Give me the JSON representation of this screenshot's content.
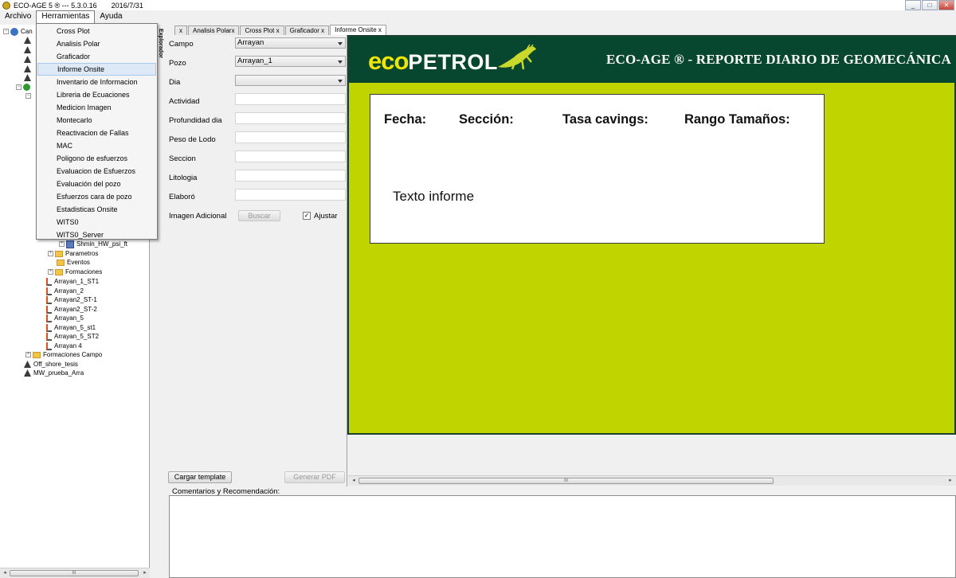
{
  "window": {
    "title": "ECO-AGE 5 ® --- 5.3.0.16",
    "date": "2016/7/31",
    "controls": [
      "_",
      "□",
      "✕"
    ]
  },
  "menubar": [
    "Archivo",
    "Herramientas",
    "Ayuda"
  ],
  "tools_menu": {
    "items": [
      "Cross Plot",
      "Analisis Polar",
      "Graficador",
      "Informe Onsite",
      "Inventario de Informacion",
      "Libreria de Ecuaciones",
      "Medicion Imagen",
      "Montecarlo",
      "Reactivacion de Fallas",
      "MAC",
      "Poligono de esfuerzos",
      "Evaluacion de Esfuerzos",
      "Evaluación del pozo",
      "Esfuerzos cara de pozo",
      "Estadisticas Onsite",
      "WITS0",
      "WITS0_Server"
    ],
    "highlighted": "Informe Onsite"
  },
  "tree": {
    "root_label": "Can",
    "visible_nodes": [
      "Shmin_HW_psi_ft",
      "Parametros",
      "Eventos",
      "Formaciones",
      "Arrayan_1_ST1",
      "Arrayan_2",
      "Arrayan2_ST-1",
      "Arrayan2_ST-2",
      "Arrayan_5",
      "Arrayan_5_st1",
      "Arrayan_5_ST2",
      "Arrayan 4",
      "Formaciones Campo",
      "Off_shore_tesis",
      "MW_prueba_Arra"
    ]
  },
  "side_label": "Explorador",
  "tabs": [
    "x",
    "Analisis Polarx",
    "Cross Plot x",
    "Graficador x",
    "Informe Onsite    x"
  ],
  "form": {
    "labels": {
      "campo": "Campo",
      "pozo": "Pozo",
      "dia": "Dia",
      "actividad": "Actividad",
      "profundidad": "Profundidad dia",
      "peso_lodo": "Peso de Lodo",
      "seccion": "Seccion",
      "litologia": "Litologia",
      "elaboro": "Elaboró",
      "imagen": "Imagen Adicional"
    },
    "campo_value": "Arrayan",
    "pozo_value": "Arrayan_1",
    "dia_value": "",
    "buscar_label": "Buscar",
    "ajustar_label": "Ajustar",
    "ajustar_checked": "✓",
    "cargar_template_label": "Cargar template",
    "generar_pdf_label": "Generar PDF"
  },
  "report": {
    "logo_part1": "eco",
    "logo_part2": "PETROL",
    "title": "ECO-AGE ®  -  REPORTE DIARIO DE GEOMECÁNICA",
    "fields": [
      "Fecha:",
      "Sección:",
      "Tasa cavings:",
      "Rango Tamaños:"
    ],
    "body_text": "Texto informe"
  },
  "comments": {
    "label": "Comentarios y Recomendación:"
  },
  "scroll_arrows": {
    "left": "◂",
    "right": "▸",
    "grip": "III"
  },
  "colors": {
    "banner": "#07462f",
    "background": "#c0d400",
    "logo_yellow": "#f1e500"
  },
  "icons": [
    "app-icon",
    "globe-icon",
    "well-icon",
    "folder-icon",
    "rig-icon",
    "iguana-logo-icon",
    "checkbox-icon",
    "caret-down-icon"
  ]
}
